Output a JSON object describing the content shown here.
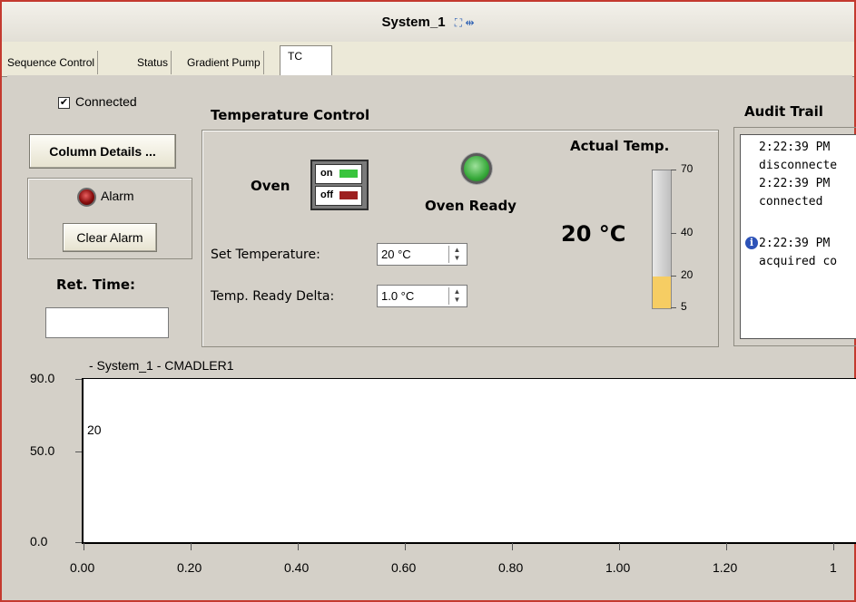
{
  "window": {
    "title": "System_1",
    "title_icons": "⛶ ⇹"
  },
  "tabs": [
    {
      "label": "Sequence Control"
    },
    {
      "label": "Status"
    },
    {
      "label": "Gradient Pump"
    },
    {
      "label": "TC",
      "active": true
    }
  ],
  "left": {
    "connected_label": "Connected",
    "connected_checked": true,
    "column_details_label": "Column Details ...",
    "alarm_label": "Alarm",
    "clear_alarm_label": "Clear Alarm",
    "ret_time_label": "Ret. Time:",
    "ret_time_value": ""
  },
  "temperature_control": {
    "title": "Temperature Control",
    "oven_label": "Oven",
    "switch_on_label": "on",
    "switch_off_label": "off",
    "oven_ready_label": "Oven Ready",
    "set_temp_label": "Set Temperature:",
    "set_temp_value": "20 °C",
    "ready_delta_label": "Temp. Ready Delta:",
    "ready_delta_value": "1.0 °C",
    "actual_temp_label": "Actual Temp.",
    "actual_temp_value": "20 °C",
    "thermometer": {
      "min": 5,
      "max": 70,
      "value": 20,
      "scale_labels": [
        "70",
        "40",
        "20",
        "5"
      ]
    }
  },
  "audit_trail": {
    "title": "Audit Trail",
    "lines": [
      "2:22:39 PM",
      "disconnecte",
      "2:22:39 PM",
      "connected",
      "2:22:39 PM",
      "acquired co"
    ],
    "info_icon": "info-icon"
  },
  "chart_data": {
    "type": "line",
    "title": "- System_1 - CMADLER1",
    "annotation": "20",
    "ylim": [
      0.0,
      90.0
    ],
    "y_ticks": [
      "90.0",
      "50.0",
      "0.0"
    ],
    "x_ticks": [
      "0.00",
      "0.20",
      "0.40",
      "0.60",
      "0.80",
      "1.00",
      "1.20",
      "1"
    ],
    "series": []
  },
  "colors": {
    "window_border": "#c43a2f",
    "panel_bg": "#d4d0c8",
    "oven_on_lamp": "#39c43d",
    "oven_off_lamp": "#9d2020",
    "thermo_fill": "#f6cd63"
  }
}
